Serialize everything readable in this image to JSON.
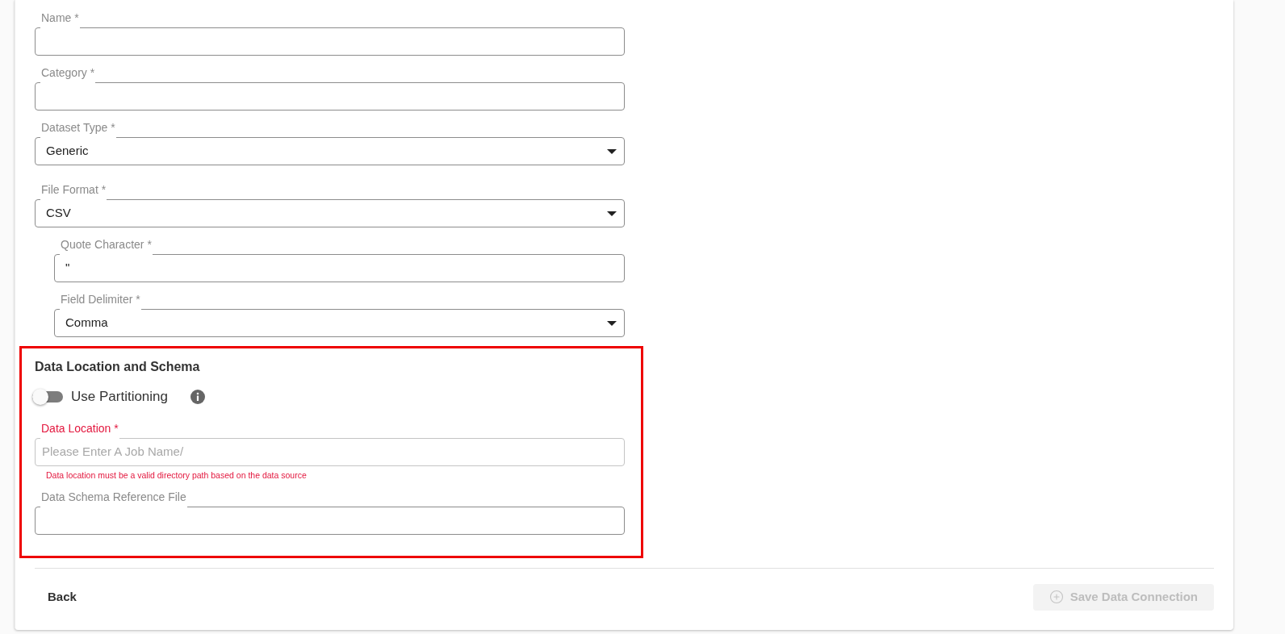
{
  "form": {
    "fields": [
      {
        "kind": "text",
        "label": "Name *"
      },
      {
        "kind": "text",
        "label": "Category *"
      },
      {
        "kind": "select",
        "label": "Dataset Type *",
        "value": "Generic"
      },
      {
        "kind": "select",
        "label": "File Format *",
        "value": "CSV",
        "children": [
          {
            "kind": "text",
            "label": "Quote Character *",
            "value": "\""
          },
          {
            "kind": "select",
            "label": "Field Delimiter *",
            "value": "Comma"
          }
        ]
      }
    ]
  },
  "section": {
    "title": "Data Location and Schema",
    "highlighted": true,
    "partitioning": {
      "label": "Use Partitioning",
      "on": false
    },
    "fields": [
      {
        "kind": "text",
        "label": "Data Location *",
        "placeholder": "Please Enter A Job Name/",
        "invalid": true,
        "error": "Data location must be a valid directory path based on the data source"
      },
      {
        "kind": "text",
        "label": "Data Schema Reference File",
        "invalid": false
      }
    ]
  },
  "footer": {
    "back": "Back",
    "save": {
      "label": "Save Data Connection",
      "disabled": true
    }
  }
}
